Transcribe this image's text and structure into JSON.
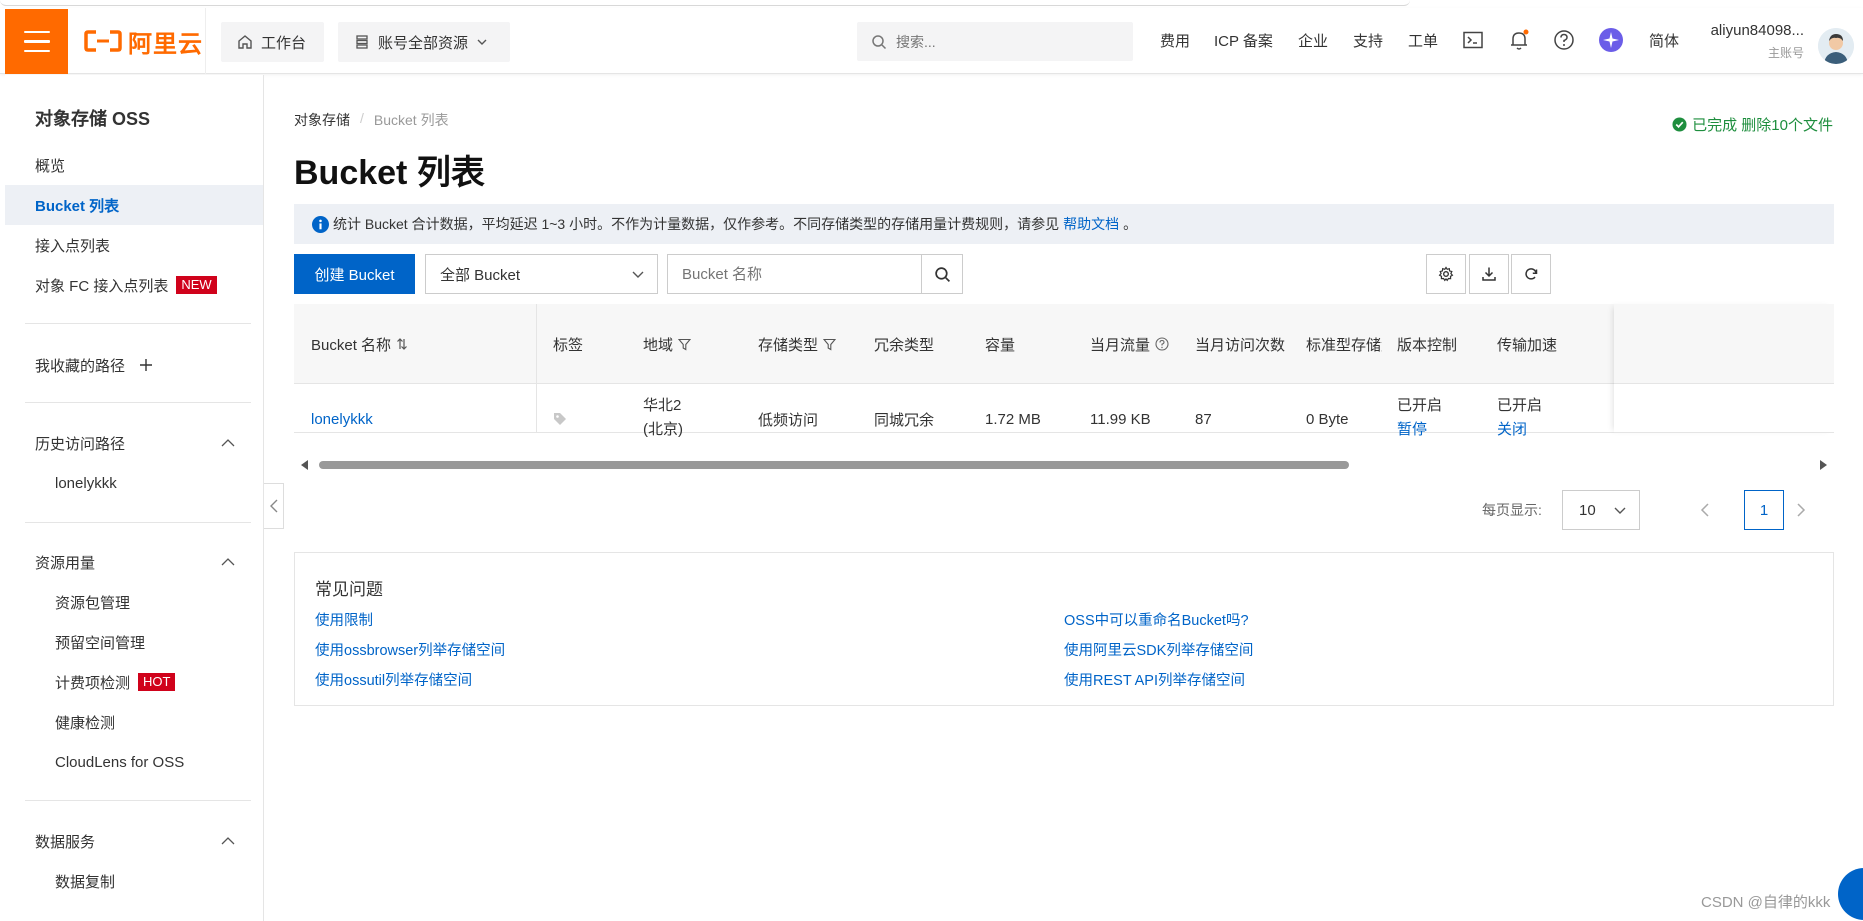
{
  "header": {
    "logo_text": "阿里云",
    "workbench_label": "工作台",
    "resources_label": "账号全部资源",
    "search_placeholder": "搜索...",
    "links": [
      "费用",
      "ICP 备案",
      "企业",
      "支持",
      "工单"
    ],
    "lang_label": "简体",
    "user_name": "aliyun84098...",
    "user_role": "主账号",
    "brand_color": "#ff6a00"
  },
  "sidebar": {
    "title": "对象存储 OSS",
    "items": [
      {
        "label": "概览"
      },
      {
        "label": "Bucket 列表"
      },
      {
        "label": "接入点列表"
      },
      {
        "label": "对象 FC 接入点列表",
        "badge": "NEW"
      }
    ],
    "favorites_label": "我收藏的路径",
    "history_label": "历史访问路径",
    "history_items": [
      "lonelykkk"
    ],
    "resources_label": "资源用量",
    "resource_items": [
      {
        "label": "资源包管理"
      },
      {
        "label": "预留空间管理"
      },
      {
        "label": "计费项检测",
        "badge": "HOT"
      },
      {
        "label": "健康检测"
      },
      {
        "label": "CloudLens for OSS"
      }
    ],
    "data_service_label": "数据服务",
    "data_service_items": [
      "数据复制"
    ]
  },
  "main": {
    "breadcrumb": [
      "对象存储",
      "Bucket 列表"
    ],
    "status": "已完成 删除10个文件",
    "title": "Bucket 列表",
    "notice_text": "统计 Bucket 合计数据，平均延迟 1~3 小时。不作为计量数据，仅作参考。不同存储类型的存储用量计费规则，请参见",
    "notice_link": "帮助文档",
    "notice_end": "。",
    "create_button": "创建 Bucket",
    "filter_select": "全部 Bucket",
    "bucket_search_placeholder": "Bucket 名称",
    "accent_color": "#0064c8"
  },
  "table": {
    "columns": [
      "Bucket 名称",
      "标签",
      "地域",
      "存储类型",
      "冗余类型",
      "容量",
      "当月流量",
      "当月访问次数",
      "标准型存储量",
      "版本控制",
      "传输加速"
    ],
    "rows": [
      {
        "name": "lonelykkk",
        "region_line1": "华北2",
        "region_line2": "(北京)",
        "storage_class": "低频访问",
        "redundancy": "同城冗余",
        "capacity": "1.72 MB",
        "traffic": "11.99 KB",
        "requests": "87",
        "standard_storage": "0 Byte",
        "versioning_status": "已开启",
        "versioning_action": "暂停",
        "acceleration_status": "已开启",
        "acceleration_action": "关闭"
      }
    ]
  },
  "pager": {
    "page_size_label": "每页显示:",
    "page_size": "10",
    "current_page": "1"
  },
  "faq": {
    "title": "常见问题",
    "left_links": [
      "使用限制",
      "使用ossbrowser列举存储空间",
      "使用ossutil列举存储空间"
    ],
    "right_links": [
      "OSS中可以重命名Bucket吗?",
      "使用阿里云SDK列举存储空间",
      "使用REST API列举存储空间"
    ]
  },
  "watermark": "CSDN @自律的kkk"
}
